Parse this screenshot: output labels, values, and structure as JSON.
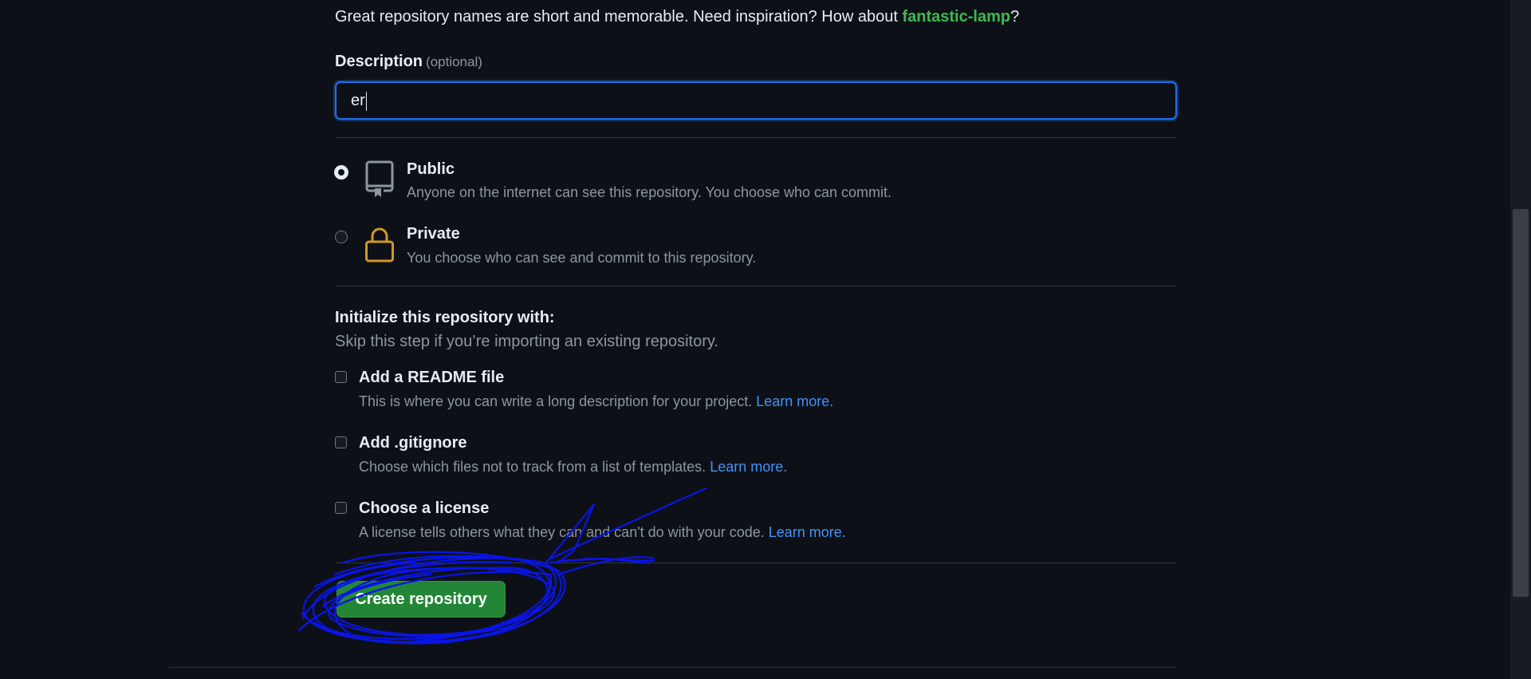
{
  "hint": {
    "prefix": "Great repository names are short and memorable. Need inspiration? How about ",
    "suggestion": "fantastic-lamp",
    "suffix": "?"
  },
  "description": {
    "label": "Description",
    "optional": "(optional)",
    "value": "er"
  },
  "visibility": {
    "public": {
      "title": "Public",
      "desc": "Anyone on the internet can see this repository. You choose who can commit.",
      "selected": true,
      "icon": "repo-icon"
    },
    "private": {
      "title": "Private",
      "desc": "You choose who can see and commit to this repository.",
      "selected": false,
      "icon": "lock-icon"
    }
  },
  "init": {
    "title": "Initialize this repository with:",
    "subtitle": "Skip this step if you’re importing an existing repository.",
    "readme": {
      "title": "Add a README file",
      "desc": "This is where you can write a long description for your project.",
      "link": "Learn more."
    },
    "gitignore": {
      "title": "Add .gitignore",
      "desc": "Choose which files not to track from a list of templates.",
      "link": "Learn more."
    },
    "license": {
      "title": "Choose a license",
      "desc": "A license tells others what they can and can't do with your code.",
      "link": "Learn more."
    }
  },
  "create_button": "Create repository",
  "colors": {
    "background": "#0d1117",
    "accent_green": "#238636",
    "suggestion_green": "#3fb950",
    "link_blue": "#4493f8",
    "focus_blue": "#1f6feb",
    "lock_yellow": "#d29922",
    "annotation_blue": "#0a14e6"
  }
}
